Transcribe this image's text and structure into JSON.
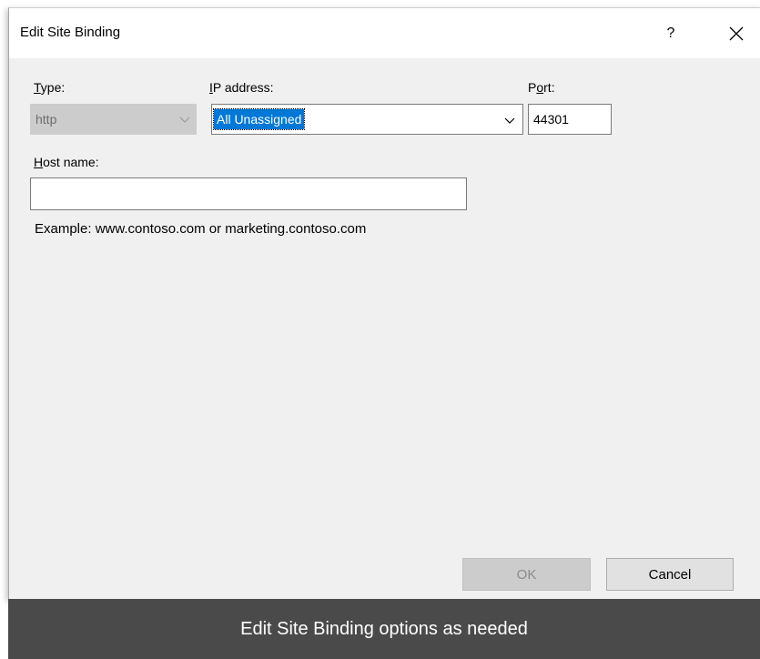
{
  "dialog": {
    "title": "Edit Site Binding",
    "help_label": "?",
    "close_label": "close"
  },
  "type_field": {
    "label_mnemonic": "T",
    "label_rest": "ype:",
    "value": "http",
    "disabled": true
  },
  "ip_field": {
    "label_mnemonic": "I",
    "label_rest": "P address:",
    "value": "All Unassigned"
  },
  "port_field": {
    "label_pre": "P",
    "label_mnemonic": "o",
    "label_rest": "rt:",
    "value": "44301"
  },
  "host_field": {
    "label_mnemonic": "H",
    "label_rest": "ost name:",
    "value": "",
    "example": "Example: www.contoso.com or marketing.contoso.com"
  },
  "buttons": {
    "ok_label": "OK",
    "cancel_label": "Cancel"
  },
  "caption": "Edit Site Binding options as needed",
  "colors": {
    "selection": "#0078d7",
    "dialog_bg": "#f0f0f0",
    "caption_bg": "#4a4a4a"
  },
  "icons": {
    "close": "close-icon",
    "dropdown": "chevron-down-icon"
  }
}
